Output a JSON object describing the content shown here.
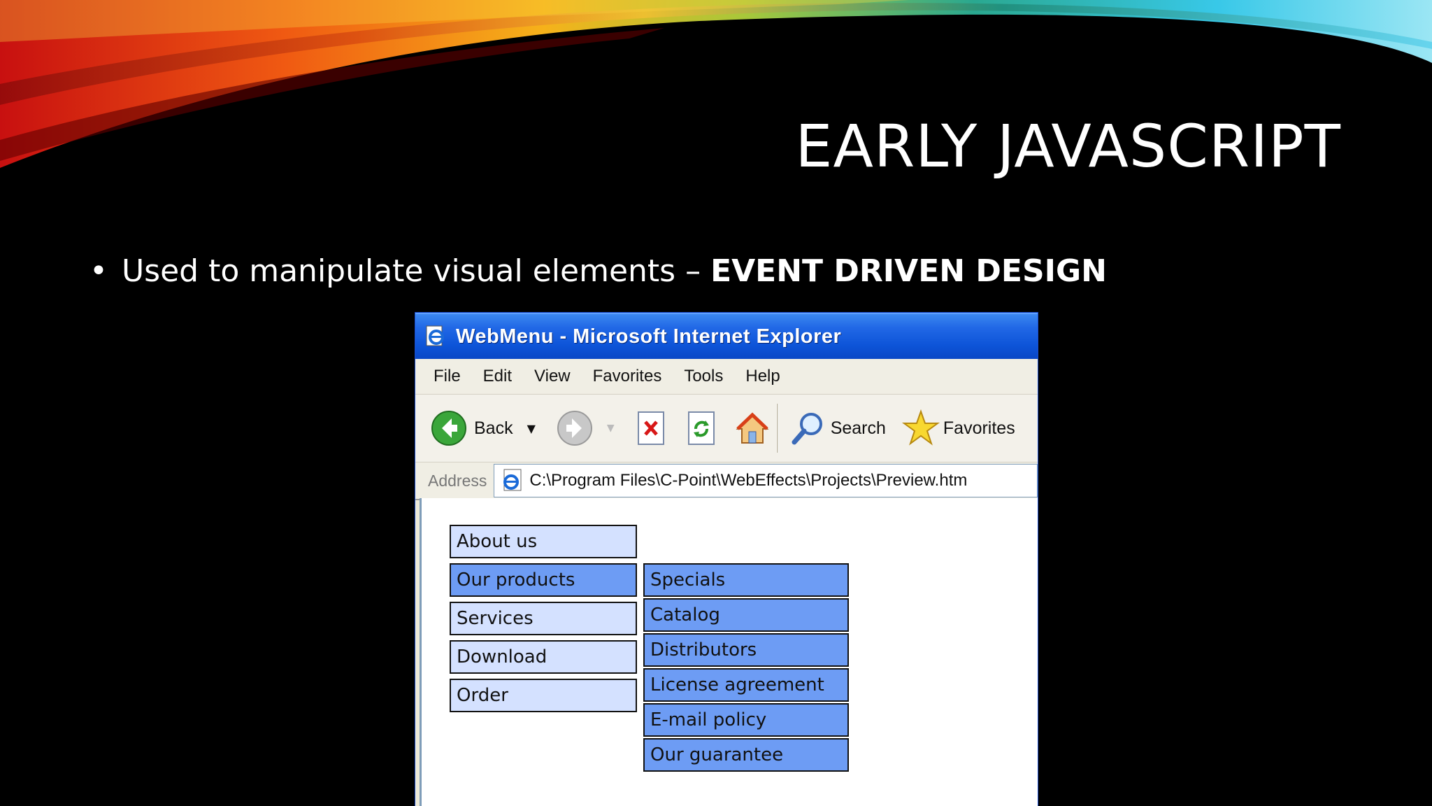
{
  "slide": {
    "title": "EARLY JAVASCRIPT",
    "bullet_text": "Used to manipulate visual elements – ",
    "bullet_bold": "EVENT DRIVEN DESIGN"
  },
  "browser": {
    "title": "WebMenu - Microsoft Internet Explorer",
    "menu": [
      "File",
      "Edit",
      "View",
      "Favorites",
      "Tools",
      "Help"
    ],
    "toolbar": {
      "back_label": "Back",
      "search_label": "Search",
      "favorites_label": "Favorites"
    },
    "address": {
      "label": "Address",
      "value": "C:\\Program Files\\C-Point\\WebEffects\\Projects\\Preview.htm"
    }
  },
  "webmenu": {
    "main_items": [
      "About us",
      "Our products",
      "Services",
      "Download",
      "Order"
    ],
    "active_index": 1,
    "sub_items": [
      "Specials",
      "Catalog",
      "Distributors",
      "License agreement",
      "E-mail policy",
      "Our guarantee"
    ]
  },
  "colors": {
    "menu_light": "#d4e1ff",
    "menu_active": "#6d9cf4",
    "titlebar": "#0d54d8"
  }
}
